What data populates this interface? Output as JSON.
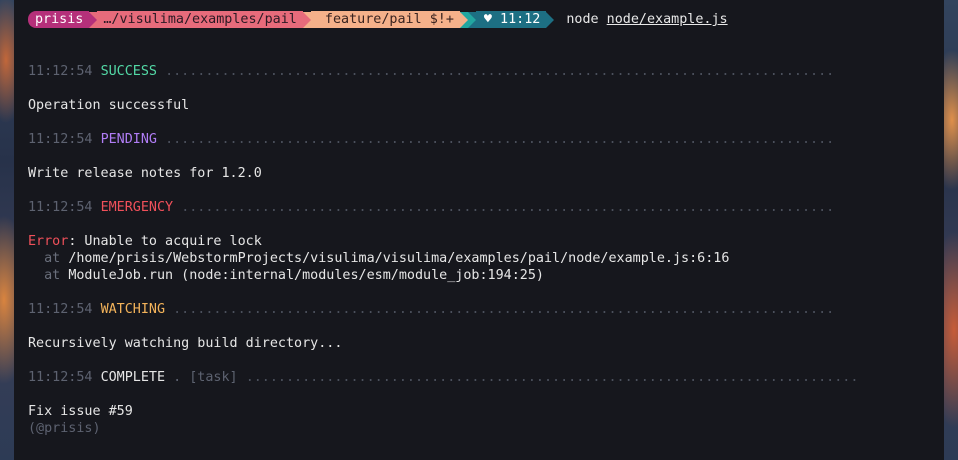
{
  "prompt": {
    "user": "prisis",
    "path": "…/visulima/examples/pail",
    "branch_icon": "",
    "git": "feature/pail $!+",
    "heart": "♥",
    "time": "11:12",
    "command": "node",
    "file": "node/example.js"
  },
  "colors": {
    "success": "#53d9a6",
    "pending": "#b07df5",
    "emergency": "#f0505a",
    "watching": "#f3b35a",
    "user_segment": "#b5307a",
    "path_segment": "#e76b7b",
    "git_segment": "#f5b18a",
    "time_segment": "#1d6f83"
  },
  "logs": [
    {
      "time": "11:12:54",
      "level": "SUCCESS",
      "dots": "...................................................................................",
      "message": "Operation successful"
    },
    {
      "time": "11:12:54",
      "level": "PENDING",
      "dots": "...................................................................................",
      "message": "Write release notes for 1.2.0"
    },
    {
      "time": "11:12:54",
      "level": "EMERGENCY",
      "dots": ".................................................................................",
      "error_label": "Error",
      "error_message": ": Unable to acquire lock",
      "stack": [
        {
          "at": "at",
          "loc": "/home/prisis/WebstormProjects/visulima/visulima/examples/pail/node/example.js:6:16"
        },
        {
          "at": "at",
          "loc": "ModuleJob.run (node:internal/modules/esm/module_job:194:25)"
        }
      ]
    },
    {
      "time": "11:12:54",
      "level": "WATCHING",
      "dots": "..................................................................................",
      "message": "Recursively watching build directory..."
    },
    {
      "time": "11:12:54",
      "level": "COMPLETE",
      "scope": ". [task]",
      "dots": "............................................................................",
      "message": "Fix issue #59",
      "suffix": "(@prisis)"
    }
  ]
}
